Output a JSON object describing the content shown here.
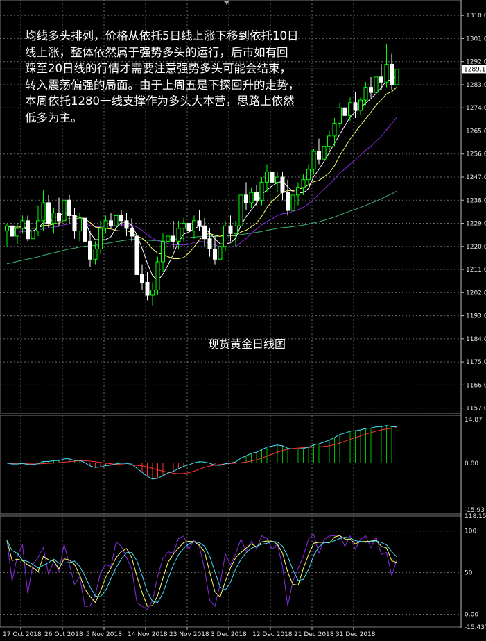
{
  "annotation": "均线多头排列，价格从依托5日线上涨下移到依托10日\n线上涨，整体依然属于强势多头的运行，后市如有回\n踩至20日线的行情才需要注意强势多头可能会结束，\n转入震荡偏强的局面。由于上周五是下探回升的走势，\n本周依托1280一线支撑作为多头大本营，思路上依然\n低多为主。",
  "chart_title": "现货黄金日线图",
  "chart_data": [
    {
      "type": "candlestick",
      "title": "现货黄金日线图",
      "ylim": [
        1155,
        1316
      ],
      "yticks": [
        "1310.0",
        "1301.0",
        "1292.0",
        "1283.0",
        "1274.0",
        "1265.0",
        "1256.0",
        "1247.0",
        "1238.0",
        "1229.0",
        "1220.0",
        "1211.0",
        "1202.0",
        "1193.0",
        "1184.0",
        "1175.0",
        "1166.0",
        "1157.0"
      ],
      "current_price": "1289.1",
      "x_dates": [
        "17 Oct 2018",
        "26 Oct 2018",
        "5 Nov 2018",
        "14 Nov 2018",
        "23 Nov 2018",
        "3 Dec 2018",
        "12 Dec 2018",
        "21 Dec 2018",
        "31 Dec 2018"
      ],
      "ohlc": [
        [
          1226,
          1229,
          1220,
          1228
        ],
        [
          1228,
          1230,
          1222,
          1224
        ],
        [
          1224,
          1229,
          1221,
          1227
        ],
        [
          1227,
          1232,
          1225,
          1230
        ],
        [
          1230,
          1232,
          1222,
          1223
        ],
        [
          1223,
          1228,
          1217,
          1226
        ],
        [
          1226,
          1236,
          1224,
          1230
        ],
        [
          1230,
          1242,
          1226,
          1237
        ],
        [
          1237,
          1240,
          1227,
          1229
        ],
        [
          1229,
          1235,
          1225,
          1233
        ],
        [
          1233,
          1239,
          1228,
          1230
        ],
        [
          1230,
          1242,
          1226,
          1238
        ],
        [
          1238,
          1240,
          1229,
          1232
        ],
        [
          1232,
          1235,
          1223,
          1226
        ],
        [
          1226,
          1233,
          1222,
          1231
        ],
        [
          1231,
          1234,
          1220,
          1222
        ],
        [
          1222,
          1226,
          1212,
          1215
        ],
        [
          1215,
          1222,
          1213,
          1219
        ],
        [
          1219,
          1230,
          1217,
          1227
        ],
        [
          1227,
          1232,
          1225,
          1230
        ],
        [
          1230,
          1233,
          1227,
          1228
        ],
        [
          1228,
          1234,
          1224,
          1232
        ],
        [
          1232,
          1234,
          1228,
          1230
        ],
        [
          1230,
          1233,
          1224,
          1227
        ],
        [
          1227,
          1231,
          1222,
          1224
        ],
        [
          1224,
          1227,
          1205,
          1209
        ],
        [
          1209,
          1213,
          1203,
          1206
        ],
        [
          1206,
          1210,
          1199,
          1201
        ],
        [
          1201,
          1206,
          1197,
          1203
        ],
        [
          1203,
          1216,
          1201,
          1214
        ],
        [
          1214,
          1225,
          1210,
          1222
        ],
        [
          1222,
          1228,
          1218,
          1224
        ],
        [
          1224,
          1230,
          1219,
          1222
        ],
        [
          1222,
          1230,
          1219,
          1227
        ],
        [
          1227,
          1231,
          1222,
          1229
        ],
        [
          1229,
          1234,
          1224,
          1226
        ],
        [
          1226,
          1232,
          1223,
          1230
        ],
        [
          1230,
          1234,
          1226,
          1228
        ],
        [
          1228,
          1231,
          1220,
          1223
        ],
        [
          1223,
          1227,
          1216,
          1219
        ],
        [
          1219,
          1224,
          1213,
          1215
        ],
        [
          1215,
          1222,
          1212,
          1220
        ],
        [
          1220,
          1230,
          1218,
          1228
        ],
        [
          1228,
          1232,
          1222,
          1225
        ],
        [
          1225,
          1230,
          1220,
          1228
        ],
        [
          1228,
          1243,
          1226,
          1240
        ],
        [
          1240,
          1245,
          1234,
          1237
        ],
        [
          1237,
          1243,
          1235,
          1241
        ],
        [
          1241,
          1244,
          1236,
          1238
        ],
        [
          1238,
          1247,
          1236,
          1245
        ],
        [
          1245,
          1252,
          1241,
          1249
        ],
        [
          1249,
          1252,
          1243,
          1245
        ],
        [
          1245,
          1249,
          1241,
          1247
        ],
        [
          1247,
          1249,
          1238,
          1241
        ],
        [
          1241,
          1246,
          1232,
          1234
        ],
        [
          1234,
          1241,
          1233,
          1240
        ],
        [
          1240,
          1245,
          1236,
          1243
        ],
        [
          1243,
          1248,
          1240,
          1246
        ],
        [
          1246,
          1252,
          1244,
          1250
        ],
        [
          1250,
          1258,
          1248,
          1257
        ],
        [
          1257,
          1262,
          1252,
          1254
        ],
        [
          1254,
          1260,
          1250,
          1259
        ],
        [
          1259,
          1265,
          1256,
          1263
        ],
        [
          1263,
          1270,
          1259,
          1268
        ],
        [
          1268,
          1276,
          1266,
          1274
        ],
        [
          1274,
          1278,
          1268,
          1271
        ],
        [
          1271,
          1278,
          1269,
          1276
        ],
        [
          1276,
          1280,
          1270,
          1273
        ],
        [
          1273,
          1278,
          1271,
          1277
        ],
        [
          1277,
          1284,
          1275,
          1282
        ],
        [
          1282,
          1286,
          1278,
          1280
        ],
        [
          1280,
          1288,
          1279,
          1286
        ],
        [
          1286,
          1291,
          1281,
          1284
        ],
        [
          1284,
          1299,
          1282,
          1291
        ],
        [
          1291,
          1295,
          1281,
          1283
        ],
        [
          1283,
          1291,
          1281,
          1289
        ]
      ],
      "ma5_color": "#ffffff",
      "ma10_color": "#ffff66",
      "ma20_color": "#8a2be2",
      "ma60_color": "#3cb371",
      "bull_color": "#00ff00",
      "bear_color": "#ffffff"
    },
    {
      "type": "macd",
      "yticks": [
        "14.87",
        "0.00",
        "-15.93"
      ],
      "ylim": [
        -15.93,
        14.87
      ],
      "main_color": "#40e0ff",
      "signal_color": "#ff3333",
      "hist_up_color": "#00c000",
      "hist_down_color": "#ff3333"
    },
    {
      "type": "oscillator",
      "yticks": [
        "118.154",
        "100",
        "50",
        "0.00",
        "-15.437"
      ],
      "ylim": [
        -15.437,
        118.154
      ],
      "line_colors": [
        "#8a2be2",
        "#ffff66",
        "#40e0ff"
      ]
    }
  ]
}
